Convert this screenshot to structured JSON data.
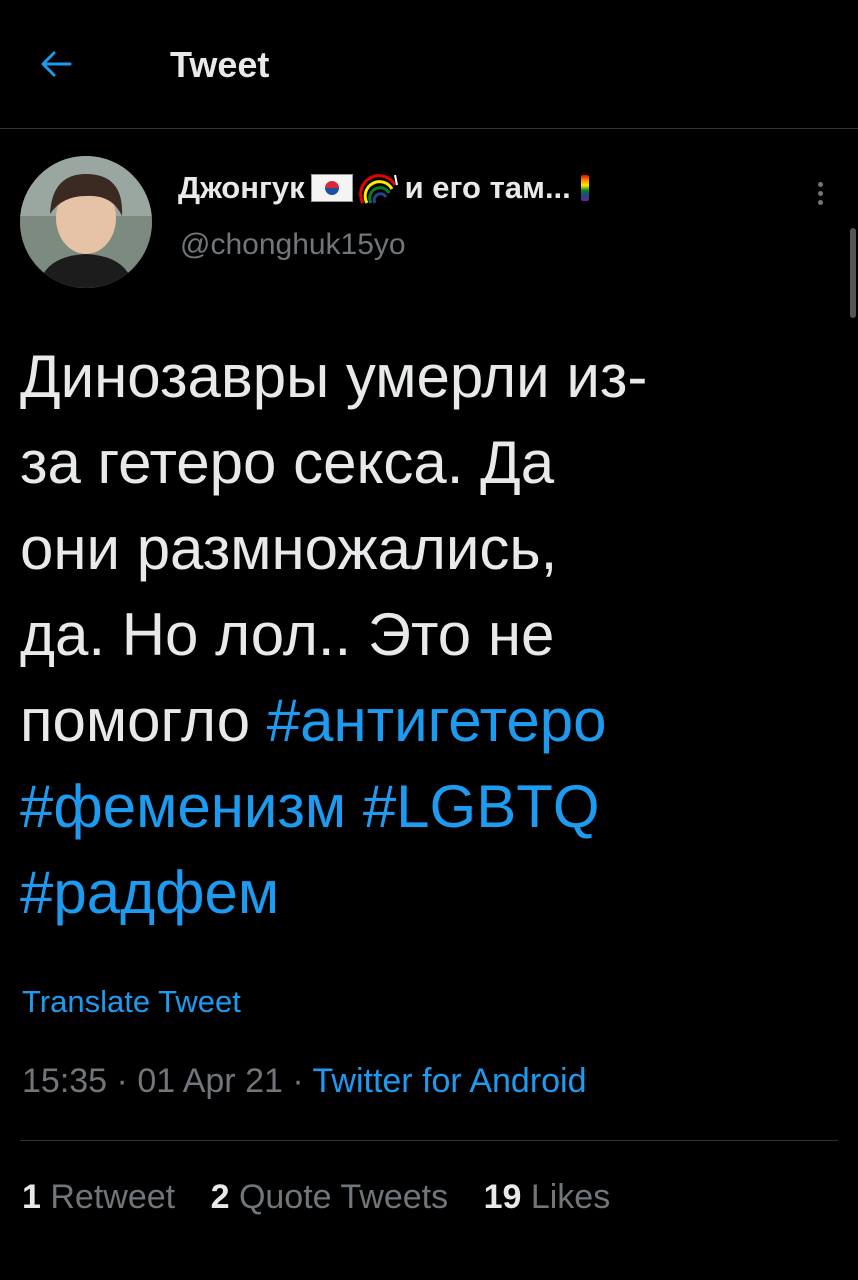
{
  "header": {
    "title": "Tweet"
  },
  "author": {
    "display_name": "Джонгук",
    "name_suffix": "и его там...",
    "handle": "@chonghuk15yo"
  },
  "tweet": {
    "text_lines": [
      "Динозавры умерли из-",
      "за гетеро секса. Да",
      "они размножались,",
      "да. Но лол.. Это не",
      "помогло "
    ],
    "hashtags": [
      "#антигетеро",
      "#фемени​зм",
      "#LGBTQ",
      "#радфем"
    ],
    "translate_label": "Translate Tweet",
    "time": "15:35",
    "date": "01 Apr 21",
    "source": "Twitter for Android"
  },
  "stats": {
    "retweets_count": "1",
    "retweets_label": "Retweet",
    "quotes_count": "2",
    "quotes_label": "Quote Tweets",
    "likes_count": "19",
    "likes_label": "Likes"
  },
  "colors": {
    "accent": "#1d9bf0",
    "background": "#000000",
    "secondary": "#71767b"
  },
  "icons": {
    "back": "arrow-left-icon",
    "more": "more-vertical-icon"
  }
}
